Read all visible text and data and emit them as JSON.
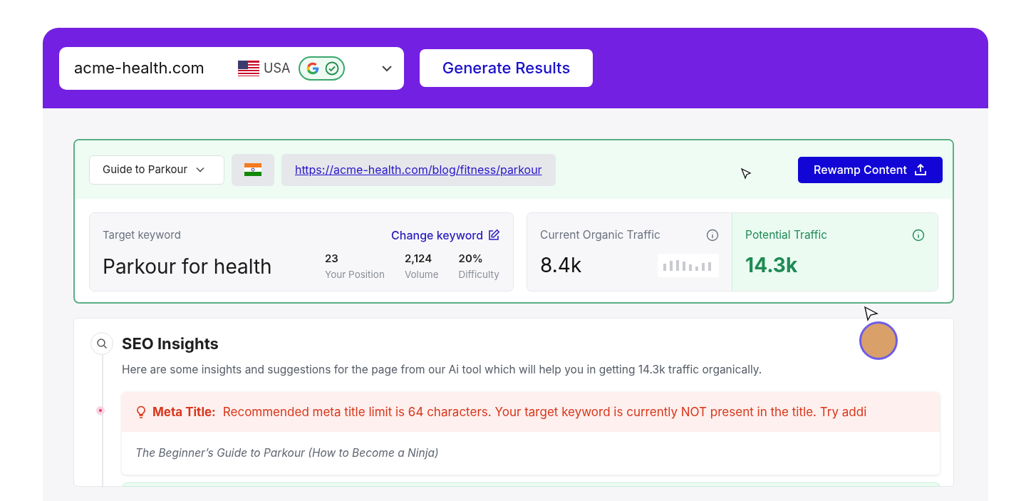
{
  "header": {
    "domain": "acme-health.com",
    "country": "USA",
    "generate_button": "Generate Results"
  },
  "page_bar": {
    "page_select": "Guide to Parkour",
    "url": "https://acme-health.com/blog/fitness/parkour",
    "rewamp_button": "Rewamp Content"
  },
  "keyword_card": {
    "label": "Target keyword",
    "change_link": "Change keyword",
    "keyword": "Parkour for health",
    "stats": [
      {
        "value": "23",
        "label": "Your Position"
      },
      {
        "value": "2,124",
        "label": "Volume"
      },
      {
        "value": "20%",
        "label": "Difficulty"
      }
    ]
  },
  "traffic": [
    {
      "kind": "current",
      "label": "Current Organic Traffic",
      "value": "8.4k"
    },
    {
      "kind": "potential",
      "label": "Potential Traffic",
      "value": "14.3k"
    }
  ],
  "insights": {
    "title": "SEO Insights",
    "description": "Here are some insights and suggestions for the page from our Ai tool which will help you in getting 14.3k traffic organically.",
    "items": [
      {
        "label": "Meta Title:",
        "message": "Recommended meta title limit is 64 characters. Your target keyword is currently NOT present in the title. Try addi",
        "current": "The Beginner’s Guide to Parkour (How to Become a Ninja)"
      }
    ]
  }
}
